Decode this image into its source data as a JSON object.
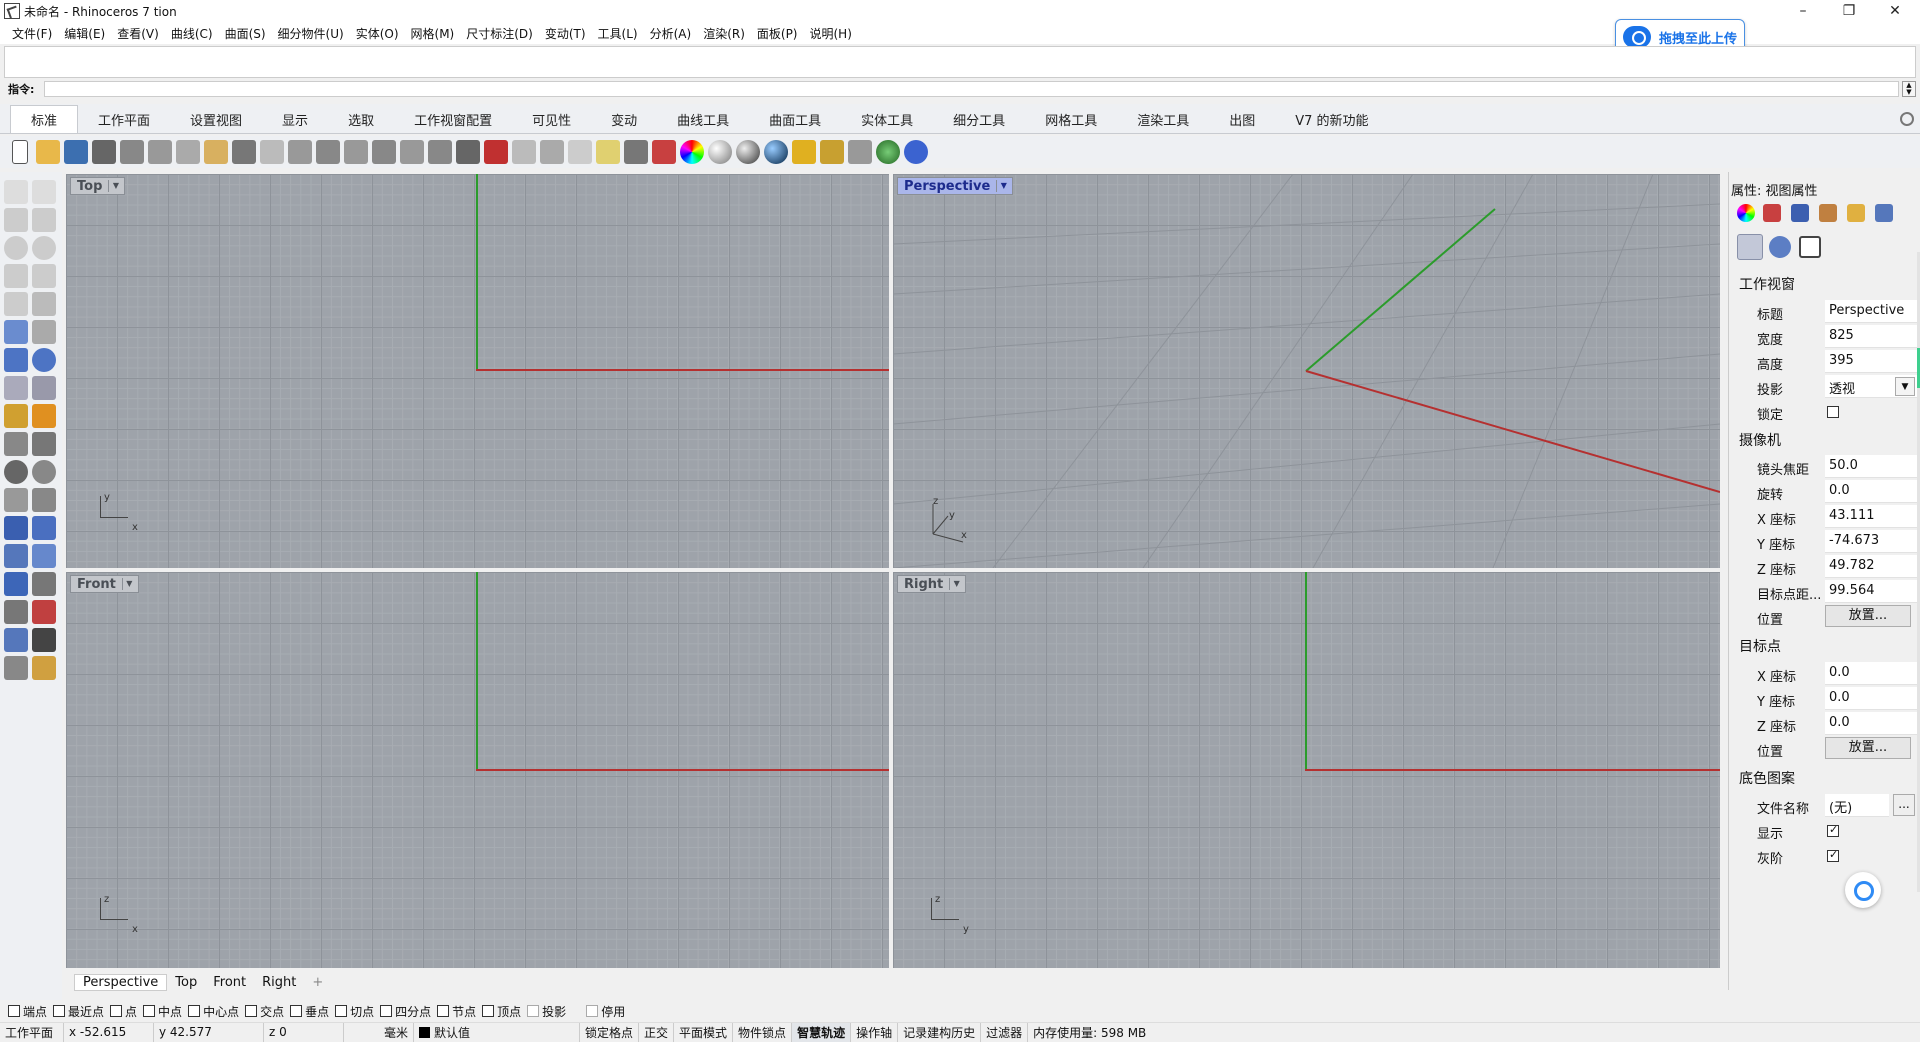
{
  "titlebar": {
    "title": "未命名 - Rhinoceros 7 tion",
    "minimize": "–",
    "maximize": "❐",
    "close": "✕"
  },
  "menu": [
    "文件(F)",
    "编辑(E)",
    "查看(V)",
    "曲线(C)",
    "曲面(S)",
    "细分物件(U)",
    "实体(O)",
    "网格(M)",
    "尺寸标注(D)",
    "变动(T)",
    "工具(L)",
    "分析(A)",
    "渲染(R)",
    "面板(P)",
    "说明(H)"
  ],
  "upload_button": "拖拽至此上传",
  "command": {
    "label": "指令:",
    "value": ""
  },
  "tabs": [
    "标准",
    "工作平面",
    "设置视图",
    "显示",
    "选取",
    "工作视窗配置",
    "可见性",
    "变动",
    "曲线工具",
    "曲面工具",
    "实体工具",
    "细分工具",
    "网格工具",
    "渲染工具",
    "出图",
    "V7 的新功能"
  ],
  "viewports": {
    "top": {
      "label": "Top",
      "axis1": "y",
      "axis2": "x"
    },
    "perspective": {
      "label": "Perspective",
      "axis1": "z",
      "axis2": "y",
      "axis3": "x"
    },
    "front": {
      "label": "Front",
      "axis1": "z",
      "axis2": "x"
    },
    "right": {
      "label": "Right",
      "axis1": "z",
      "axis2": "y"
    }
  },
  "viewport_tabs": [
    "Perspective",
    "Top",
    "Front",
    "Right"
  ],
  "viewport_tab_add": "+",
  "snaps": [
    {
      "label": "端点",
      "checked": false
    },
    {
      "label": "最近点",
      "checked": false
    },
    {
      "label": "点",
      "checked": false
    },
    {
      "label": "中点",
      "checked": false
    },
    {
      "label": "中心点",
      "checked": false
    },
    {
      "label": "交点",
      "checked": false
    },
    {
      "label": "垂点",
      "checked": false
    },
    {
      "label": "切点",
      "checked": false
    },
    {
      "label": "四分点",
      "checked": false
    },
    {
      "label": "节点",
      "checked": false
    },
    {
      "label": "顶点",
      "checked": false
    },
    {
      "label": "投影",
      "checked": false
    },
    {
      "label": "停用",
      "checked": false
    }
  ],
  "status": {
    "cplane": "工作平面",
    "x": "x -52.615",
    "y": "y 42.577",
    "z": "z 0",
    "unit": "毫米",
    "layer": "默认值",
    "grid_snap": "锁定格点",
    "ortho": "正交",
    "planar": "平面模式",
    "osnap": "物件锁点",
    "smarttrack": "智慧轨迹",
    "gumball": "操作轴",
    "history": "记录建构历史",
    "filter": "过滤器",
    "memory": "内存使用量: 598 MB"
  },
  "panel": {
    "title": "属性: 视图属性",
    "viewport_section": "工作视窗",
    "title_label": "标题",
    "title_value": "Perspective",
    "width_label": "宽度",
    "width_value": "825",
    "height_label": "高度",
    "height_value": "395",
    "projection_label": "投影",
    "projection_value": "透视",
    "lock_label": "锁定",
    "camera_section": "摄像机",
    "lens_label": "镜头焦距",
    "lens_value": "50.0",
    "rotation_label": "旋转",
    "rotation_value": "0.0",
    "cam_x_label": "X 座标",
    "cam_x_value": "43.111",
    "cam_y_label": "Y 座标",
    "cam_y_value": "-74.673",
    "cam_z_label": "Z 座标",
    "cam_z_value": "49.782",
    "target_dist_label": "目标点距...",
    "target_dist_value": "99.564",
    "location_label": "位置",
    "place_button": "放置...",
    "target_section": "目标点",
    "tgt_x_label": "X 座标",
    "tgt_x_value": "0.0",
    "tgt_y_label": "Y 座标",
    "tgt_y_value": "0.0",
    "tgt_z_label": "Z 座标",
    "tgt_z_value": "0.0",
    "tgt_location_label": "位置",
    "tgt_place_button": "放置...",
    "wallpaper_section": "底色图案",
    "filename_label": "文件名称",
    "filename_value": "(无)",
    "browse_button": "...",
    "show_label": "显示",
    "gray_label": "灰阶"
  }
}
